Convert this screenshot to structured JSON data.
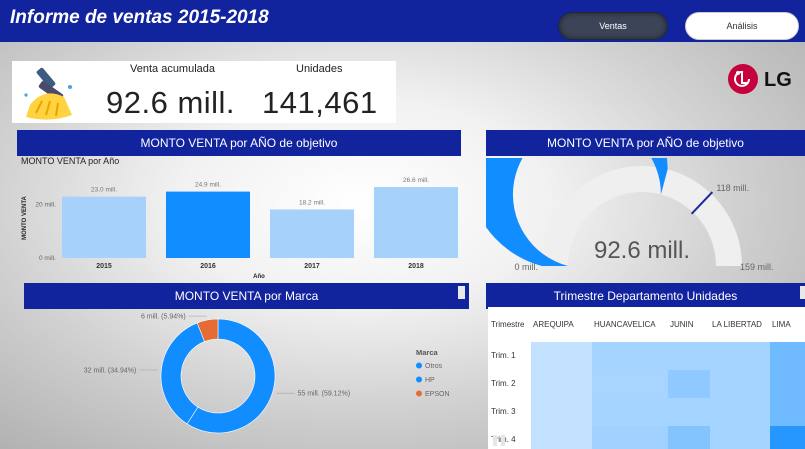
{
  "header": {
    "title": "Informe de ventas 2015-2018",
    "tabs": [
      {
        "label": "Ventas",
        "active": true
      },
      {
        "label": "Análisis",
        "active": false
      }
    ]
  },
  "kpis": {
    "venta_label": "Venta acumulada",
    "venta_value": "92.6 mill.",
    "unidades_label": "Unidades",
    "unidades_value": "141,461"
  },
  "brand": {
    "logo_text": "LG",
    "logo_color": "#c5003d",
    "icon": "broom-icon"
  },
  "colors": {
    "navy": "#12239e",
    "bar_light": "#a5d1fb",
    "bar_blue": "#118dff",
    "pie_orange": "#e66c37"
  },
  "bar_panel": {
    "title": "MONTO VENTA por AÑO de objetivo",
    "subtitle": "MONTO VENTA por Año",
    "chart_data": {
      "type": "bar",
      "categories": [
        "2015",
        "2016",
        "2017",
        "2018"
      ],
      "values": [
        23.0,
        24.9,
        18.2,
        26.6
      ],
      "data_labels": [
        "23.0 mill.",
        "24.9 mill.",
        "18.2 mill.",
        "26.6 mill."
      ],
      "highlighted": "2016",
      "xlabel": "Año",
      "ylabel": "MONTO VENTA",
      "yticks": [
        "0 mill.",
        "20 mill."
      ],
      "ylim": [
        0,
        30
      ]
    }
  },
  "gauge_panel": {
    "title": "MONTO VENTA por AÑO de objetivo",
    "value": 92.6,
    "value_label": "92.6 mill.",
    "min": 0,
    "min_label": "0 mill.",
    "max": 159,
    "max_label": "159 mill.",
    "target": 118,
    "target_label": "118 mill."
  },
  "donut_panel": {
    "title": "MONTO VENTA por Marca",
    "legend_title": "Marca",
    "chart_data": {
      "type": "pie",
      "categories": [
        "HP",
        "Otros",
        "EPSON"
      ],
      "values": [
        59.12,
        34.94,
        5.94
      ],
      "labels": [
        "55 mill. (59.12%)",
        "32 mill. (34.94%)",
        "6 mill. (5.94%)"
      ],
      "colors": [
        "#118dff",
        "#118dff",
        "#e66c37"
      ],
      "legend": [
        "Otros",
        "HP",
        "EPSON"
      ],
      "legend_colors": [
        "#118dff",
        "#118dff",
        "#e66c37"
      ]
    }
  },
  "matrix_panel": {
    "title": "Trimestre Departamento Unidades",
    "chart_data": {
      "type": "heatmap",
      "row_header": "Trimestre",
      "columns": [
        "AREQUIPA",
        "HUANCAVELICA",
        "JUNIN",
        "LA LIBERTAD",
        "LIMA"
      ],
      "rows": [
        "Trim. 1",
        "Trim. 2",
        "Trim. 3",
        "Trim. 4"
      ],
      "intensity": [
        [
          0.15,
          0.3,
          0.3,
          0.3,
          0.55
        ],
        [
          0.15,
          0.28,
          0.4,
          0.3,
          0.55
        ],
        [
          0.15,
          0.3,
          0.3,
          0.3,
          0.55
        ],
        [
          0.15,
          0.32,
          0.45,
          0.3,
          0.9
        ]
      ]
    }
  }
}
